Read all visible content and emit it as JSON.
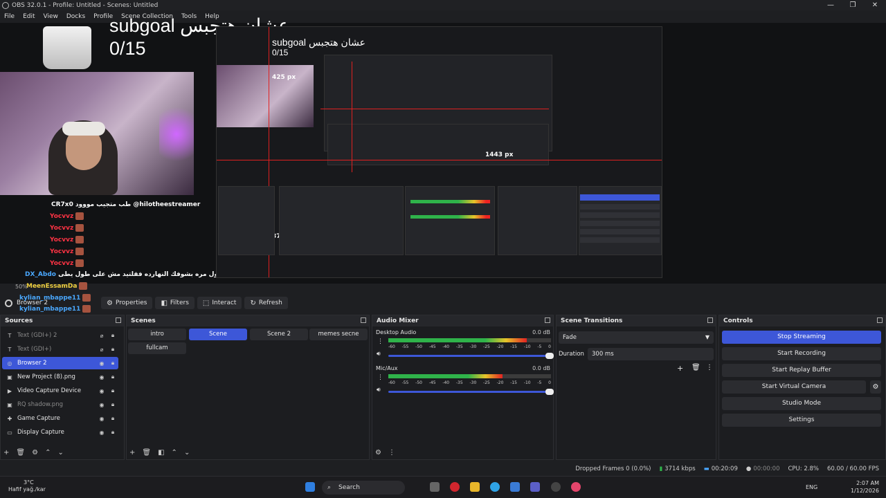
{
  "window": {
    "title": "OBS 32.0.1 - Profile: Untitled - Scenes: Untitled",
    "controls": [
      "—",
      "❐",
      "✕"
    ]
  },
  "menu": [
    "File",
    "Edit",
    "View",
    "Docks",
    "Profile",
    "Scene Collection",
    "Tools",
    "Help"
  ],
  "preview": {
    "overlay_text": "subgoal عشان هتجبس",
    "overlay_count": "0/15",
    "nested_px_labels": [
      "425 px",
      "1443 px",
      "372 px"
    ],
    "zoom": "50%",
    "chat": [
      {
        "user": "CR7x0",
        "text": "طب متجيب مووود @hilotheestreamer",
        "color": "white"
      },
      {
        "user": "Yocvvz",
        "text": "",
        "color": "red"
      },
      {
        "user": "Yocvvz",
        "text": "",
        "color": "red"
      },
      {
        "user": "Yocvvz",
        "text": "",
        "color": "red"
      },
      {
        "user": "Yocvvz",
        "text": "",
        "color": "red"
      },
      {
        "user": "Yocvvz",
        "text": "",
        "color": "red"
      },
      {
        "user": "DX_Abdo",
        "text": "بسطا هو اول مره بشوفك النهارده فقلتيد مش على طول يطى",
        "color": "blue"
      },
      {
        "user": "MeenEssamDa",
        "text": "",
        "color": "yellow"
      },
      {
        "user": "kylian_mbappe11",
        "text": "",
        "color": "blue"
      },
      {
        "user": "kylian_mbappe11",
        "text": "",
        "color": "blue"
      },
      {
        "user": "kylian_mbappe11",
        "text": "",
        "color": "blue"
      }
    ]
  },
  "source_toolbar": {
    "selected_source": "Browser 2",
    "buttons": [
      {
        "label": "Properties",
        "icon": "gear-icon"
      },
      {
        "label": "Filters",
        "icon": "filter-icon"
      },
      {
        "label": "Interact",
        "icon": "cursor-icon"
      },
      {
        "label": "Refresh",
        "icon": "refresh-icon"
      }
    ]
  },
  "sources": {
    "title": "Sources",
    "items": [
      {
        "name": "Text (GDI+) 2",
        "icon": "text-icon",
        "visible": false
      },
      {
        "name": "Text (GDI+)",
        "icon": "text-icon",
        "visible": false
      },
      {
        "name": "Browser 2",
        "icon": "globe-icon",
        "visible": true,
        "selected": true
      },
      {
        "name": "New Project (8).png",
        "icon": "image-icon",
        "visible": true
      },
      {
        "name": "Video Capture Device",
        "icon": "camera-icon",
        "visible": true
      },
      {
        "name": "RQ shadow.png",
        "icon": "image-icon",
        "visible": false
      },
      {
        "name": "Game Capture",
        "icon": "gamepad-icon",
        "visible": true
      },
      {
        "name": "Display Capture",
        "icon": "monitor-icon",
        "visible": true
      }
    ]
  },
  "scenes": {
    "title": "Scenes",
    "items": [
      "intro",
      "Scene",
      "Scene 2",
      "memes secne",
      "fullcam"
    ],
    "active": "Scene"
  },
  "audio_mixer": {
    "title": "Audio Mixer",
    "channels": [
      {
        "name": "Desktop Audio",
        "db": "0.0 dB",
        "level": 0.85
      },
      {
        "name": "Mic/Aux",
        "db": "0.0 dB",
        "level": 0.7
      }
    ],
    "ticks": [
      "-60",
      "-55",
      "-50",
      "-45",
      "-40",
      "-35",
      "-30",
      "-25",
      "-20",
      "-15",
      "-10",
      "-5",
      "0"
    ]
  },
  "transitions": {
    "title": "Scene Transitions",
    "selected": "Fade",
    "duration_label": "Duration",
    "duration_value": "300 ms"
  },
  "controls": {
    "title": "Controls",
    "buttons": [
      "Stop Streaming",
      "Start Recording",
      "Start Replay Buffer",
      "Start Virtual Camera",
      "Studio Mode",
      "Settings"
    ]
  },
  "status": {
    "dropped_frames": "Dropped Frames 0 (0.0%)",
    "bitrate": "3714 kbps",
    "stream_time": "00:20:09",
    "rec_time": "00:00:00",
    "cpu": "CPU: 2.8%",
    "fps": "60.00 / 60.00 FPS"
  },
  "taskbar": {
    "temp": "3°C",
    "weather": "Hafif yağ./kar",
    "search": "Search",
    "lang": "ENG",
    "time": "2:07 AM",
    "date": "1/12/2026"
  },
  "colors": {
    "accent": "#3d57d8",
    "meter_green": "#2fb34a",
    "meter_yellow": "#e6c42a",
    "meter_red": "#e22222"
  }
}
